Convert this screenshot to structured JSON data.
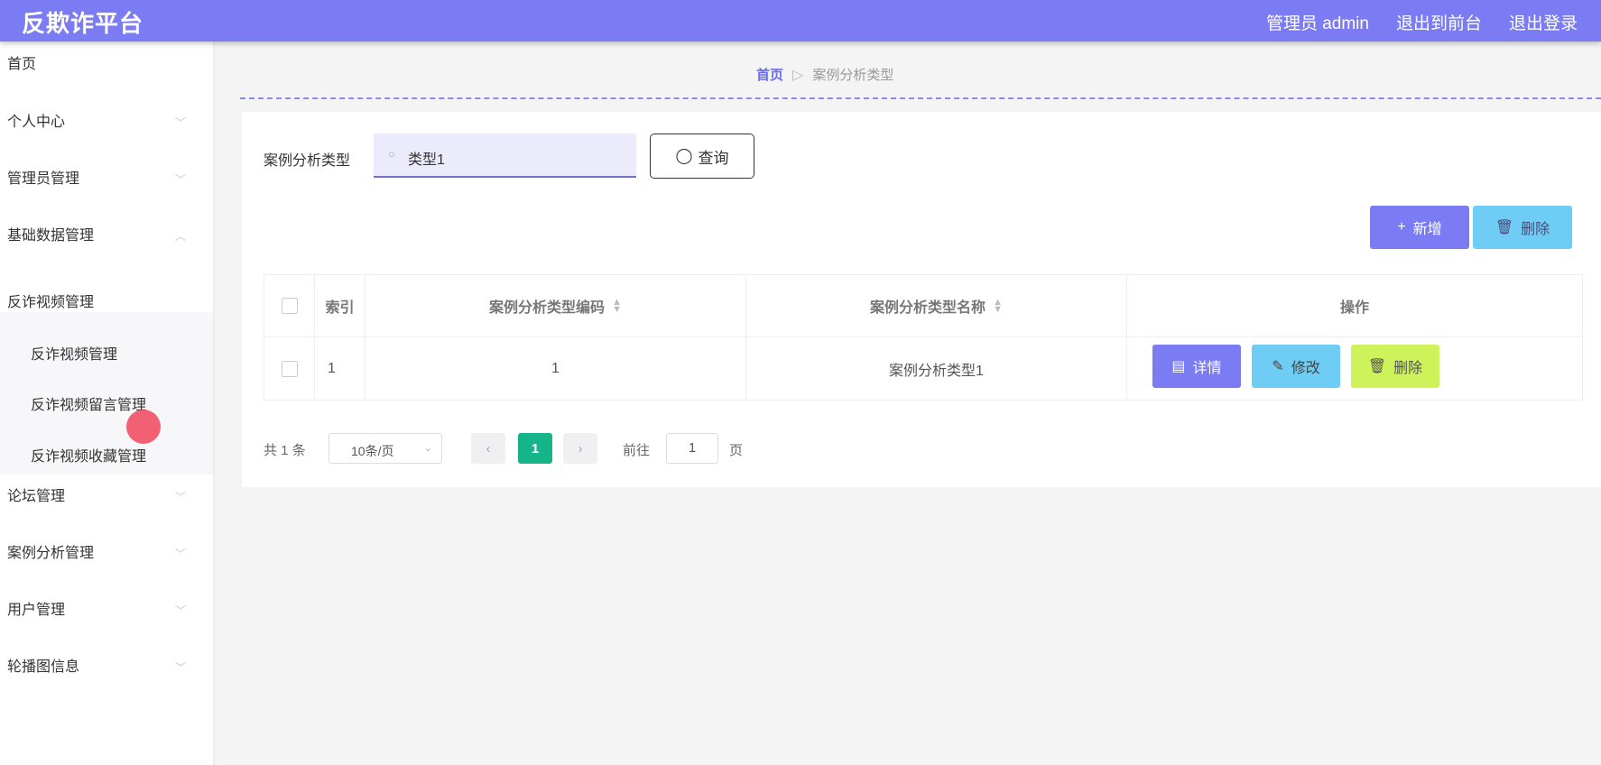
{
  "app": {
    "title": "反欺诈平台"
  },
  "topbar": {
    "user": "管理员 admin",
    "to_front": "退出到前台",
    "logout": "退出登录"
  },
  "sidebar": {
    "items": [
      {
        "label": "首页"
      },
      {
        "label": "个人中心"
      },
      {
        "label": "管理员管理"
      },
      {
        "label": "基础数据管理"
      },
      {
        "label": "反诈视频管理"
      },
      {
        "label": "论坛管理"
      },
      {
        "label": "案例分析管理"
      },
      {
        "label": "用户管理"
      },
      {
        "label": "轮播图信息"
      }
    ],
    "subitems": [
      {
        "label": "反诈视频管理"
      },
      {
        "label": "反诈视频留言管理"
      },
      {
        "label": "反诈视频收藏管理"
      }
    ]
  },
  "breadcrumb": {
    "home": "首页",
    "current": "案例分析类型"
  },
  "search": {
    "label": "案例分析类型",
    "value": "类型1",
    "button": "查询"
  },
  "actions": {
    "add": "新增",
    "delete": "删除"
  },
  "table": {
    "headers": {
      "index": "索引",
      "code": "案例分析类型编码",
      "name": "案例分析类型名称",
      "ops": "操作"
    },
    "rows": [
      {
        "index": "1",
        "code": "1",
        "name": "案例分析类型1"
      }
    ],
    "row_actions": {
      "detail": "详情",
      "edit": "修改",
      "delete": "删除"
    }
  },
  "pagination": {
    "total": "共 1 条",
    "page_size": "10条/页",
    "current_page": "1",
    "goto_label": "前往",
    "goto_value": "1",
    "page_unit": "页"
  },
  "colors": {
    "accent": "#7b7cf3",
    "info": "#6fcdf5",
    "warning": "#cdf25a",
    "page_active": "#16b489"
  },
  "icons": {
    "search": "search-icon",
    "plus": "plus-icon",
    "trash": "trash-icon",
    "detail": "document-icon",
    "edit": "pencil-icon",
    "chevron": "chevron-down-icon",
    "sort": "sort-icon"
  }
}
